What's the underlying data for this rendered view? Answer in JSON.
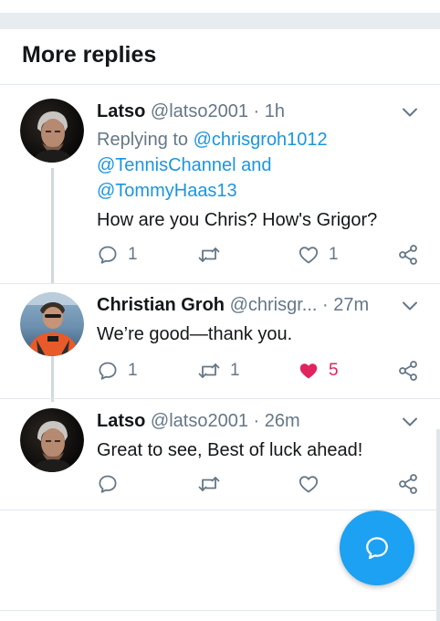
{
  "section": {
    "title": "More replies"
  },
  "tweets": [
    {
      "name": "Latso",
      "meta": "@latso2001 · 1h",
      "reply_prefix": "Replying to ",
      "mentions": [
        "@chrisgroh1012",
        "@TennisChannel",
        "@TommyHaas13"
      ],
      "reply_and": " and",
      "text": "How are you Chris? How's Grigor?",
      "replies": "1",
      "retweets": "",
      "likes": "1",
      "liked": false
    },
    {
      "name": "Christian Groh",
      "meta": "@chrisgr... · 27m",
      "text": "We’re good—thank you.",
      "replies": "1",
      "retweets": "1",
      "likes": "5",
      "liked": true
    },
    {
      "name": "Latso",
      "meta": "@latso2001 · 26m",
      "text": "Great to see, Best of luck ahead!",
      "replies": "",
      "retweets": "",
      "likes": "",
      "liked": false
    }
  ],
  "icons": {
    "reply": "reply-icon",
    "retweet": "retweet-icon",
    "like": "heart-icon",
    "share": "share-icon",
    "more": "chevron-down-icon",
    "compose": "compose-reply-icon"
  },
  "colors": {
    "accent": "#1da1f2",
    "mention": "#1b95e0",
    "like": "#e0245e",
    "muted": "#657786"
  }
}
